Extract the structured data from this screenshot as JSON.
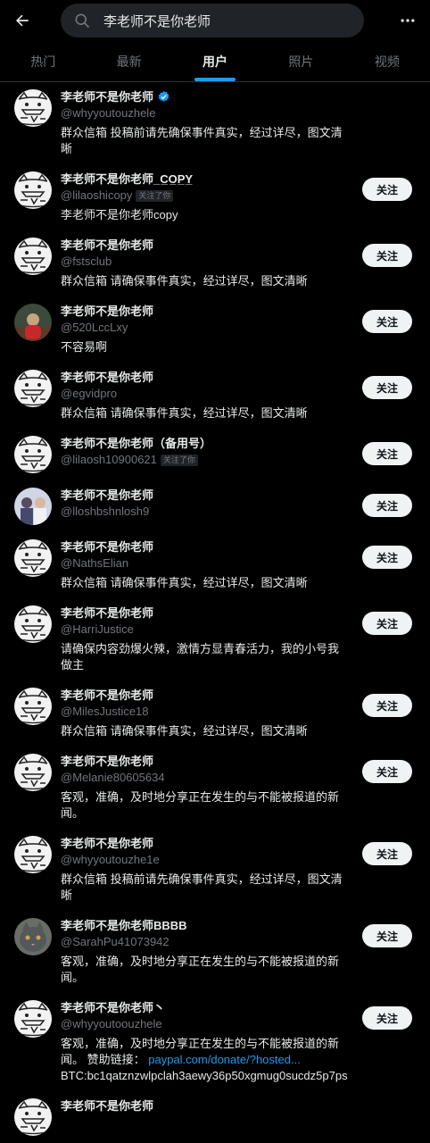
{
  "search": {
    "value": "李老师不是你老师"
  },
  "tabs": [
    {
      "label": "热门",
      "active": false
    },
    {
      "label": "最新",
      "active": false
    },
    {
      "label": "用户",
      "active": true
    },
    {
      "label": "照片",
      "active": false
    },
    {
      "label": "视频",
      "active": false
    }
  ],
  "follows_you_label": "关注了你",
  "users": [
    {
      "name": "李老师不是你老师",
      "handle": "@whyyoutouzhele",
      "bio": "群众信箱 投稿前请先确保事件真实，经过详尽，图文清晰",
      "verified": true,
      "follows_you": false,
      "button": "",
      "avatar": "cat"
    },
    {
      "name": "李老师不是你老师_C̲O̲P̲Y̲",
      "handle": "@lilaoshicopy",
      "bio": "李老师不是你老师copy",
      "verified": false,
      "follows_you": true,
      "button": "关注",
      "avatar": "cat"
    },
    {
      "name": "李老师不是你老师",
      "handle": "@fstsclub",
      "bio": "群众信箱 请确保事件真实，经过详尽，图文清晰",
      "verified": false,
      "follows_you": false,
      "button": "关注",
      "avatar": "cat"
    },
    {
      "name": "李老师不是你老师",
      "handle": "@520LccLxy",
      "bio": "不容易啊",
      "verified": false,
      "follows_you": false,
      "button": "关注",
      "avatar": "photo-red"
    },
    {
      "name": "李老师不是你老师",
      "handle": "@egvidpro",
      "bio": "群众信箱 请确保事件真实，经过详尽，图文清晰",
      "verified": false,
      "follows_you": false,
      "button": "关注",
      "avatar": "cat"
    },
    {
      "name": "李老师不是你老师（备用号）",
      "handle": "@lilaosh10900621",
      "bio": "",
      "verified": false,
      "follows_you": true,
      "button": "关注",
      "avatar": "cat"
    },
    {
      "name": "李老师不是你老师",
      "handle": "@lloshbshnlosh9",
      "bio": "",
      "verified": false,
      "follows_you": false,
      "button": "关注",
      "avatar": "photo-people"
    },
    {
      "name": "李老师不是你老师",
      "handle": "@NathsElian",
      "bio": "群众信箱 请确保事件真实，经过详尽，图文清晰",
      "verified": false,
      "follows_you": false,
      "button": "关注",
      "avatar": "cat"
    },
    {
      "name": "李老师不是你老师",
      "handle": "@HarriJustice",
      "bio": "请确保内容劲爆火辣，激情方显青春活力，我的小号我做主",
      "verified": false,
      "follows_you": false,
      "button": "关注",
      "avatar": "cat"
    },
    {
      "name": "李老师不是你老师",
      "handle": "@MilesJustice18",
      "bio": "群众信箱 请确保事件真实，经过详尽，图文清晰",
      "verified": false,
      "follows_you": false,
      "button": "关注",
      "avatar": "cat"
    },
    {
      "name": "李老师不是你老师",
      "handle": "@Melanie80605634",
      "bio": "客观，准确，及时地分享正在发生的与不能被报道的新闻。",
      "verified": false,
      "follows_you": false,
      "button": "关注",
      "avatar": "cat"
    },
    {
      "name": "李老师不是你老师",
      "handle": "@whyyoutouzhe1e",
      "bio": "群众信箱 投稿前请先确保事件真实，经过详尽，图文清晰",
      "verified": false,
      "follows_you": false,
      "button": "关注",
      "avatar": "cat"
    },
    {
      "name": "李老师不是你老师BBBB",
      "handle": "@SarahPu41073942",
      "bio": "客观，准确，及时地分享正在发生的与不能被报道的新闻。",
      "verified": false,
      "follows_you": false,
      "button": "关注",
      "avatar": "photo-cat"
    },
    {
      "name": "李老师不是你老师丶",
      "handle": "@whyyoutoouzhele",
      "bio": "客观，准确，及时地分享正在发生的与不能被报道的新闻。 赞助链接：",
      "bio_link": "paypal.com/donate/?hosted...",
      "bio_tail": "BTC:bc1qatznzwlpclah3aewy36p50xgmug0sucdz5p7ps",
      "verified": false,
      "follows_you": false,
      "button": "关注",
      "avatar": "cat"
    },
    {
      "name": "李老师不是你老师",
      "handle": "",
      "bio": "",
      "verified": false,
      "follows_you": false,
      "button": "",
      "avatar": "cat"
    }
  ],
  "colors": {
    "accent": "#1d9bf0",
    "background": "#000000",
    "muted": "#71767b"
  }
}
